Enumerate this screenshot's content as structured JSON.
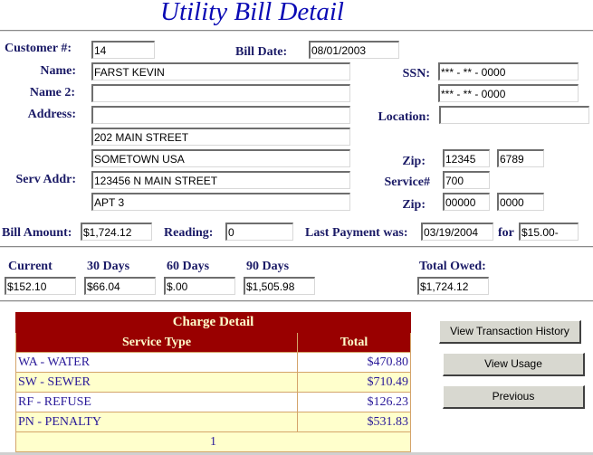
{
  "header": {
    "title": "Utility Bill Detail"
  },
  "customer": {
    "customer_no_label": "Customer #:",
    "customer_no": "14",
    "bill_date_label": "Bill Date:",
    "bill_date": "08/01/2003",
    "name_label": "Name:",
    "name": "FARST KEVIN",
    "name2_label": "Name 2:",
    "name2": "",
    "address_label": "Address:",
    "address_lines": [
      "",
      "202 MAIN STREET",
      "SOMETOWN USA"
    ],
    "serv_addr_label": "Serv Addr:",
    "serv_addr_lines": [
      "123456 N MAIN STREET",
      "APT 3"
    ],
    "ssn_label": "SSN:",
    "ssn_lines": [
      "*** - ** - 0000",
      "*** - ** - 0000"
    ],
    "location_label": "Location:",
    "location": "",
    "zip_label": "Zip:",
    "zip": "12345",
    "zip_ext": "6789",
    "service_no_label": "Service#",
    "service_no": "700",
    "serv_zip_label": "Zip:",
    "serv_zip": "00000",
    "serv_zip_ext": "0000"
  },
  "billing": {
    "bill_amount_label": "Bill Amount:",
    "bill_amount": "$1,724.12",
    "reading_label": "Reading:",
    "reading": "0",
    "last_payment_label": "Last Payment was:",
    "last_payment_date": "03/19/2004",
    "for_label": "for",
    "last_payment_amount": "$15.00-"
  },
  "aging": {
    "current_label": "Current",
    "current": "$152.10",
    "d30_label": "30 Days",
    "d30": "$66.04",
    "d60_label": "60 Days",
    "d60": "$.00",
    "d90_label": "90 Days",
    "d90": "$1,505.98",
    "total_label": "Total Owed:",
    "total": "$1,724.12"
  },
  "charges": {
    "caption": "Charge Detail",
    "columns": [
      "Service Type",
      "Total"
    ],
    "rows": [
      {
        "service": "WA - WATER",
        "total": "$470.80"
      },
      {
        "service": "SW - SEWER",
        "total": "$710.49"
      },
      {
        "service": "RF - REFUSE",
        "total": "$126.23"
      },
      {
        "service": "PN - PENALTY",
        "total": "$531.83"
      }
    ],
    "page": "1"
  },
  "buttons": {
    "transaction_history": "View Transaction History",
    "usage": "View Usage",
    "previous": "Previous"
  },
  "colors": {
    "title": "#0a0ab4",
    "label": "#1a1a66",
    "grid_header_bg": "#990000",
    "grid_header_text": "#ffffcc",
    "grid_alt_row": "#ffffcc",
    "grid_text": "#2a1a99"
  }
}
